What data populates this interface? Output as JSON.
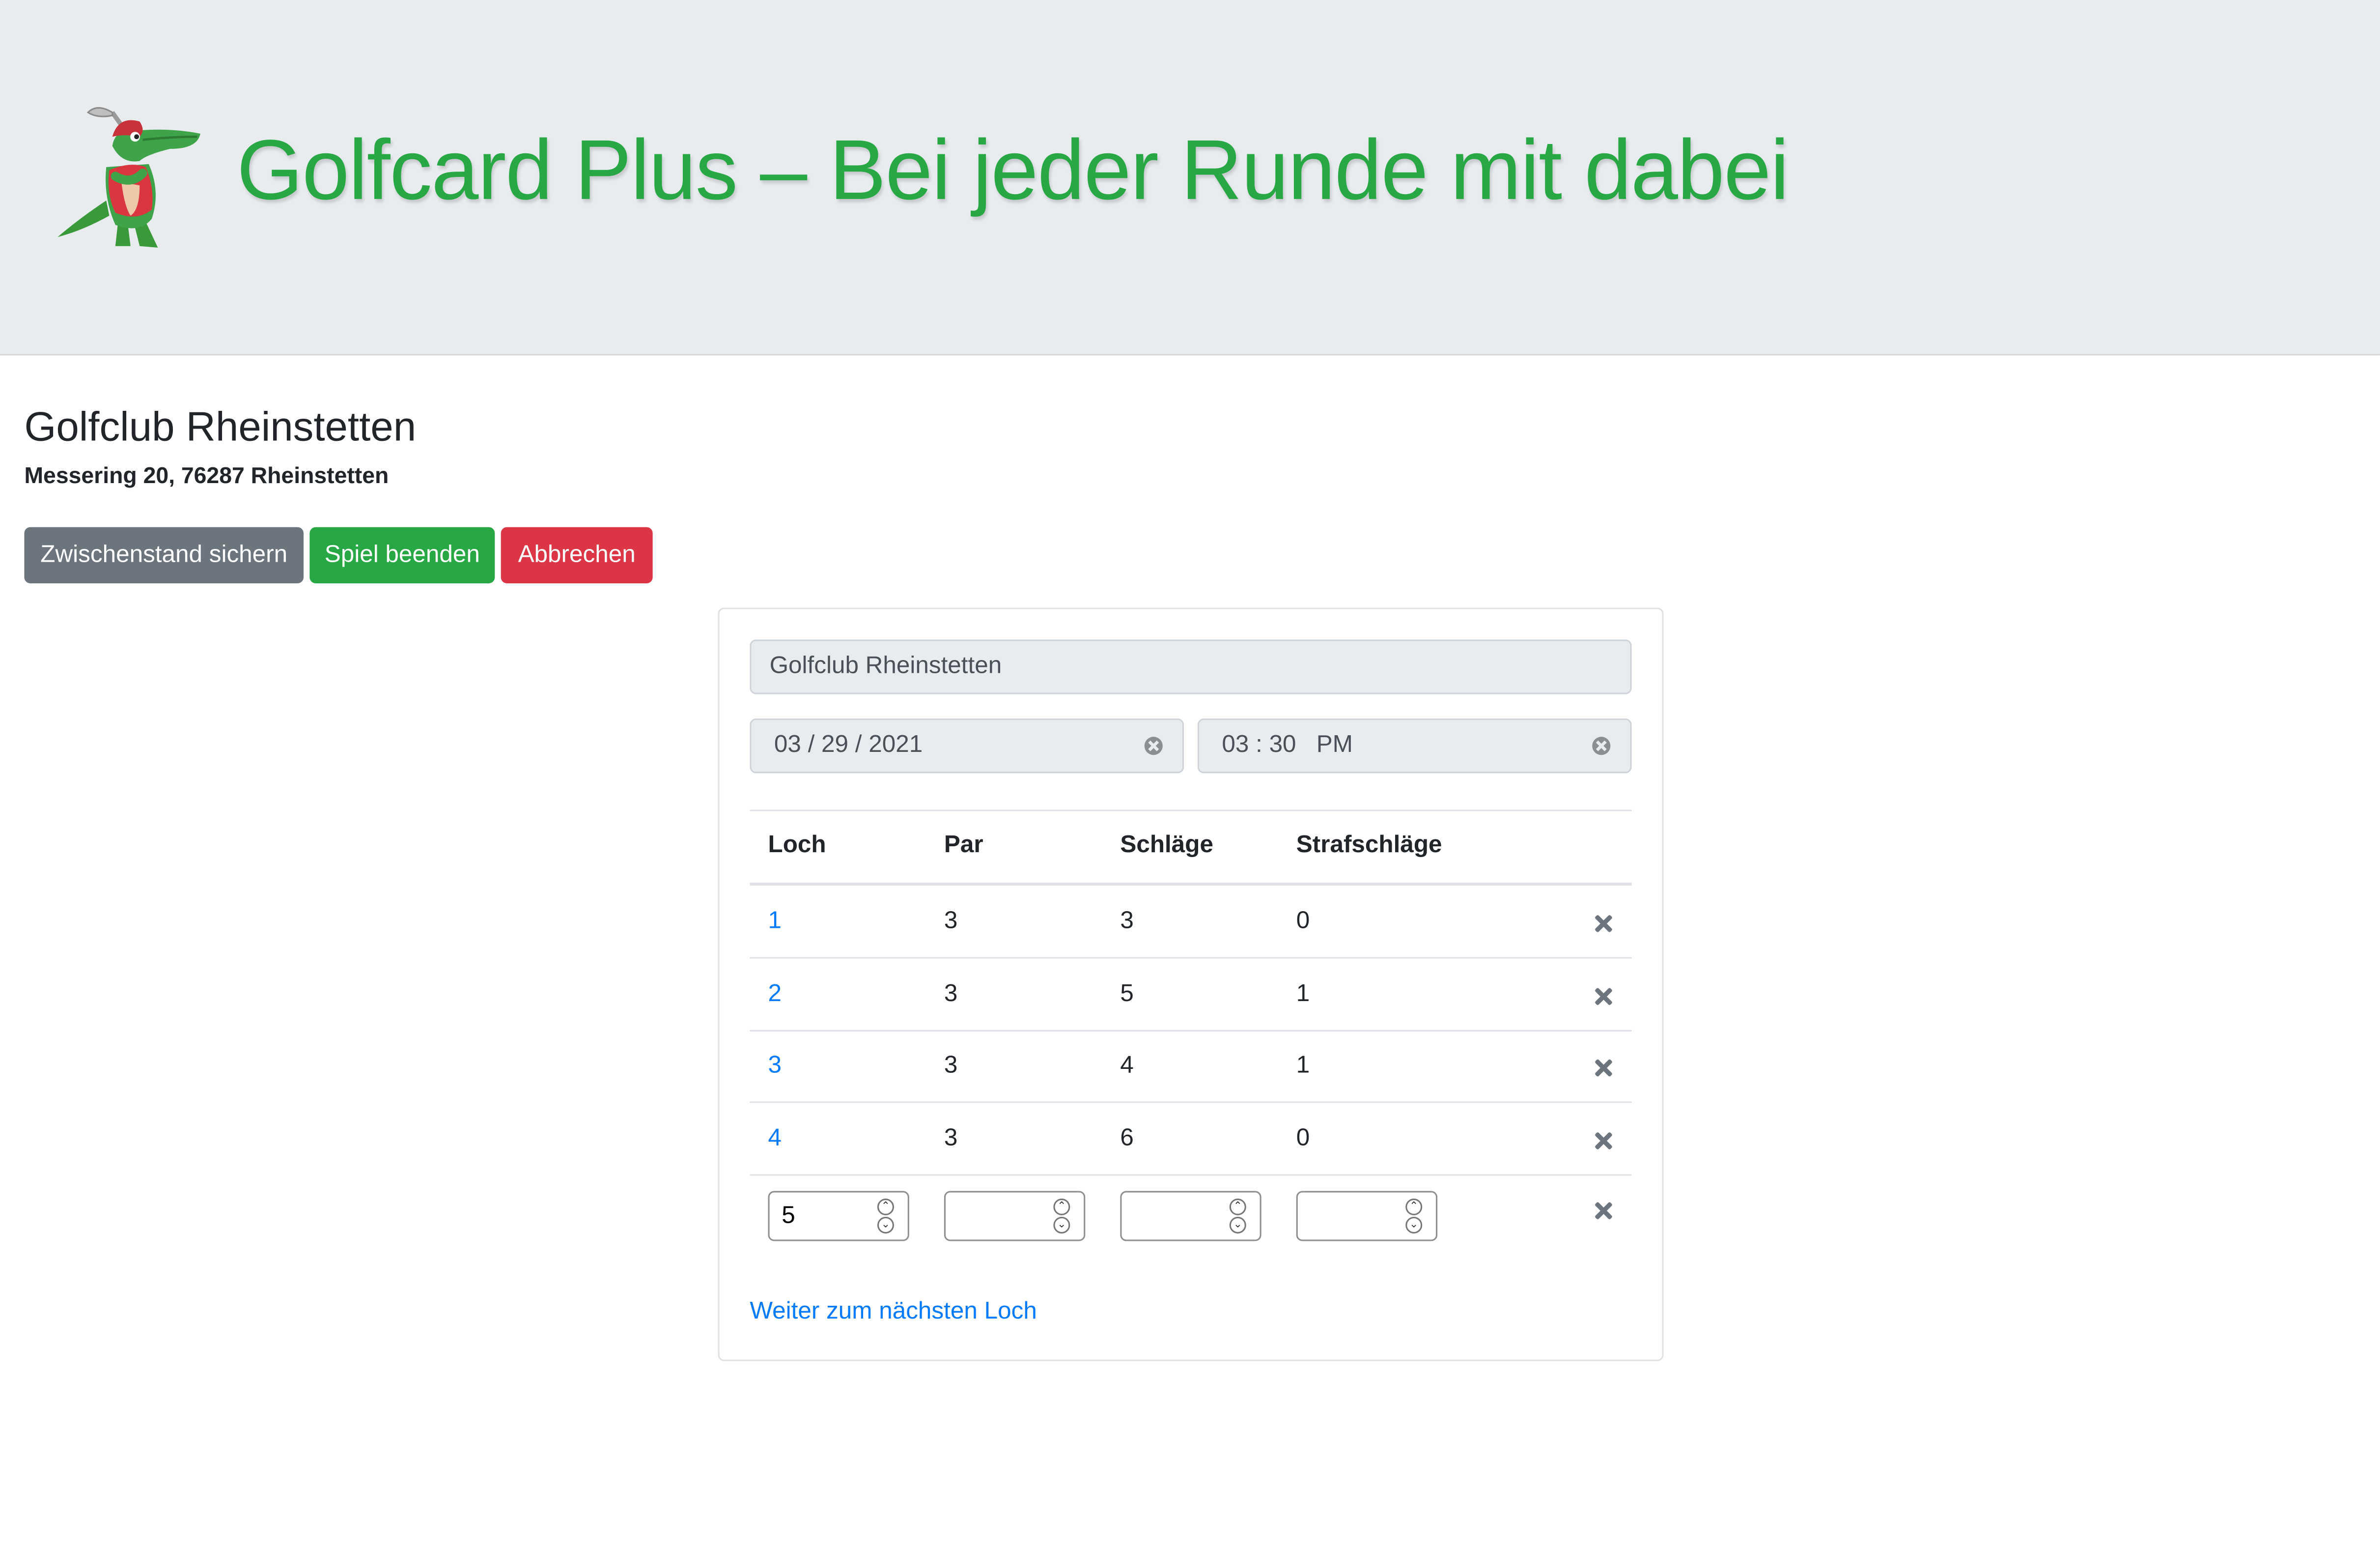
{
  "header": {
    "title": "Golfcard Plus – Bei jeder Runde mit dabei",
    "logo_icon": "crocodile-golfer-logo"
  },
  "course": {
    "name": "Golfclub Rheinstetten",
    "address": "Messering 20, 76287 Rheinstetten"
  },
  "actions": {
    "save_label": "Zwischenstand sichern",
    "finish_label": "Spiel beenden",
    "cancel_label": "Abbrechen"
  },
  "form": {
    "course_value": "Golfclub Rheinstetten",
    "date_value": "03 / 29 / 2021",
    "time_value": "03 : 30   PM"
  },
  "table": {
    "headers": [
      "Loch",
      "Par",
      "Schläge",
      "Strafschläge"
    ],
    "rows": [
      {
        "hole": "1",
        "par": "3",
        "strokes": "3",
        "penalty": "0"
      },
      {
        "hole": "2",
        "par": "3",
        "strokes": "5",
        "penalty": "1"
      },
      {
        "hole": "3",
        "par": "3",
        "strokes": "4",
        "penalty": "1"
      },
      {
        "hole": "4",
        "par": "3",
        "strokes": "6",
        "penalty": "0"
      }
    ],
    "new_row": {
      "hole": "5",
      "par": "",
      "strokes": "",
      "penalty": ""
    }
  },
  "next_hole_label": "Weiter zum nächsten Loch",
  "colors": {
    "accent_green": "#28a745",
    "secondary": "#6c757d",
    "danger": "#dc3545",
    "link": "#007bff",
    "header_bg": "#e9ecef"
  }
}
